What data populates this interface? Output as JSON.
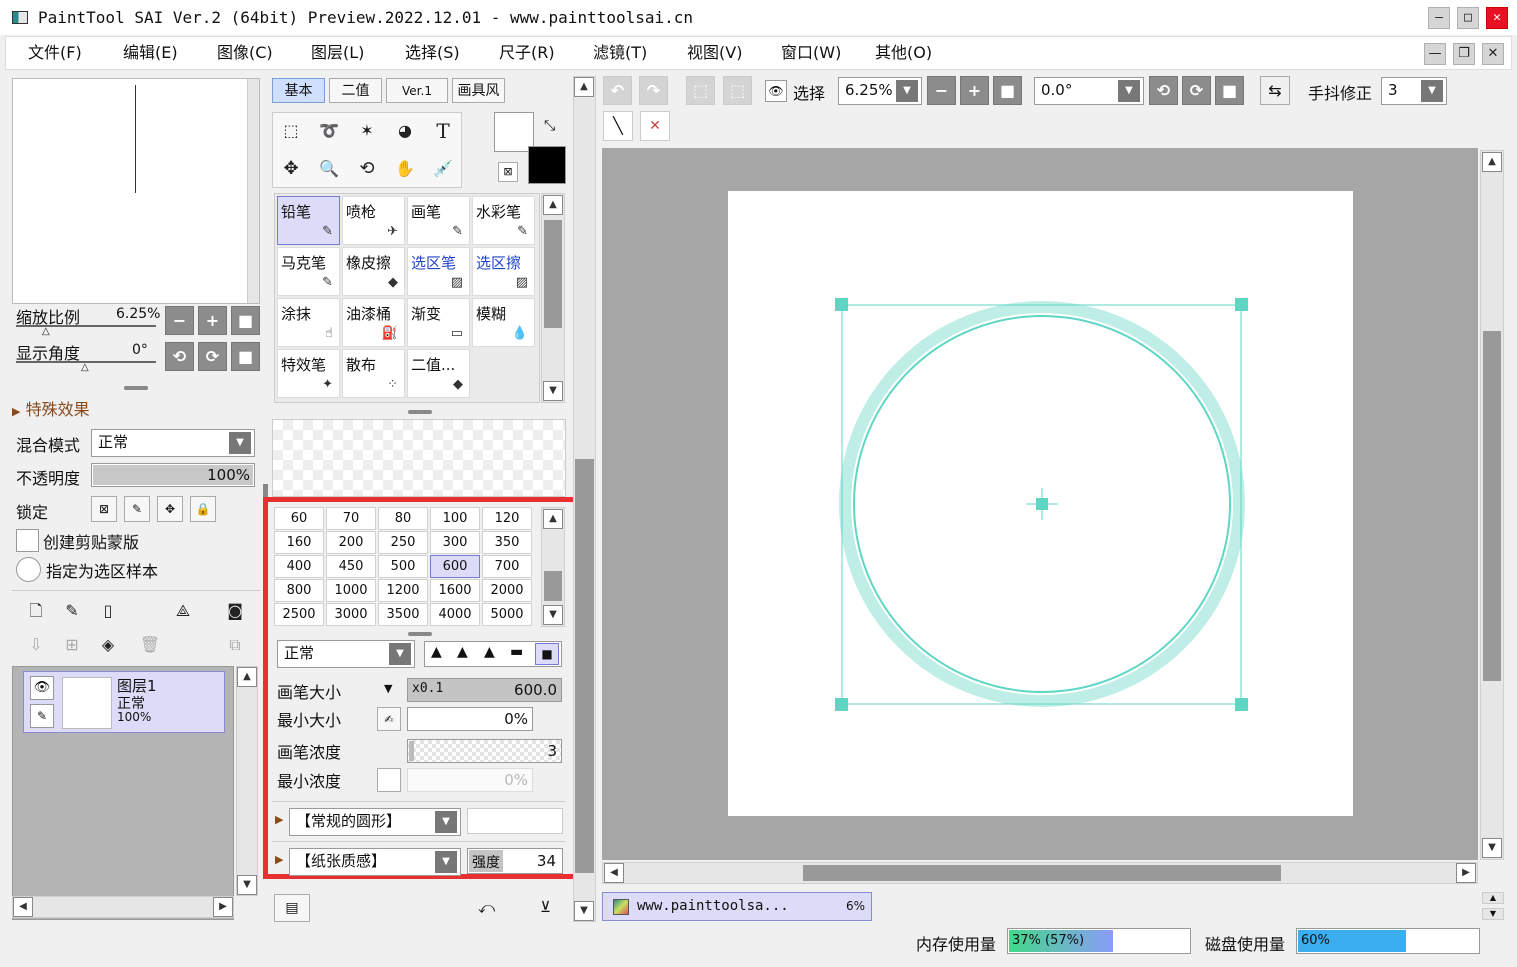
{
  "window": {
    "title": "PaintTool SAI Ver.2 (64bit) Preview.2022.12.01 - www.painttoolsai.cn",
    "min": "—",
    "max": "□",
    "close": "✕"
  },
  "menu": [
    "文件(F)",
    "编辑(E)",
    "图像(C)",
    "图层(L)",
    "选择(S)",
    "尺子(R)",
    "滤镜(T)",
    "视图(V)",
    "窗口(W)",
    "其他(O)"
  ],
  "menu_right": {
    "min": "—",
    "restore": "❐",
    "close": "✕"
  },
  "navigator": {
    "zoom_label": "缩放比例",
    "zoom_value": "6.25%",
    "angle_label": "显示角度",
    "angle_value": "0°"
  },
  "effects": {
    "label": "特殊效果"
  },
  "layer_props": {
    "blend_label": "混合模式",
    "blend_value": "正常",
    "opacity_label": "不透明度",
    "opacity_value": "100%",
    "opacity_fraction": 1.0,
    "lock_label": "锁定",
    "clip_label": "创建剪贴蒙版",
    "sample_label": "指定为选区样本"
  },
  "layers": [
    {
      "name": "图层1",
      "mode": "正常",
      "opacity": "100%"
    }
  ],
  "tool_tabs": [
    "基本",
    "二值",
    "Ver.1",
    "画具风"
  ],
  "tools": [
    {
      "name": "铅笔",
      "icon": "✎"
    },
    {
      "name": "喷枪",
      "icon": "✈"
    },
    {
      "name": "画笔",
      "icon": "✎"
    },
    {
      "name": "水彩笔",
      "icon": "✎"
    },
    {
      "name": "马克笔",
      "icon": "✎"
    },
    {
      "name": "橡皮擦",
      "icon": "◆"
    },
    {
      "name": "选区笔",
      "icon": "▨"
    },
    {
      "name": "选区擦",
      "icon": "▨"
    },
    {
      "name": "涂抹",
      "icon": "☝"
    },
    {
      "name": "油漆桶",
      "icon": "⛽"
    },
    {
      "name": "渐变",
      "icon": "▭"
    },
    {
      "name": "模糊",
      "icon": "💧"
    },
    {
      "name": "特效笔",
      "icon": "✦"
    },
    {
      "name": "散布",
      "icon": "⁘"
    },
    {
      "name": "二值...",
      "icon": "◆"
    },
    {
      "name": "",
      "icon": ""
    }
  ],
  "brush_sizes": [
    "60",
    "70",
    "80",
    "100",
    "120",
    "160",
    "200",
    "250",
    "300",
    "350",
    "400",
    "450",
    "500",
    "600",
    "700",
    "800",
    "1000",
    "1200",
    "1600",
    "2000",
    "2500",
    "3000",
    "3500",
    "4000",
    "5000"
  ],
  "brush_settings": {
    "blend": "正常",
    "size_label": "画笔大小",
    "size_mult": "x0.1",
    "size_value": "600.0",
    "min_size_label": "最小大小",
    "min_size_value": "0%",
    "density_label": "画笔浓度",
    "density_value": "3",
    "min_density_label": "最小浓度",
    "min_density_value": "0%",
    "shape": "【常规的圆形】",
    "texture": "【纸张质感】",
    "strength_label": "强度",
    "strength_value": "34"
  },
  "toolbar": {
    "select_label": "选择",
    "zoom_value": "6.25%",
    "angle_value": "0.0°",
    "stabilizer_label": "手抖修正",
    "stabilizer_value": "3"
  },
  "document_tab": {
    "name": "www.painttoolsa...",
    "zoom": "6%"
  },
  "status": {
    "memory_label": "内存使用量",
    "memory_value": "37% (57%)",
    "memory_fraction": 0.37,
    "disk_label": "磁盘使用量",
    "disk_value": "60%",
    "disk_fraction": 0.6
  },
  "colors": {
    "accent_teal": "#5ed6c4",
    "selection_blue": "#dcdcf8",
    "highlight_red": "#e83030"
  }
}
